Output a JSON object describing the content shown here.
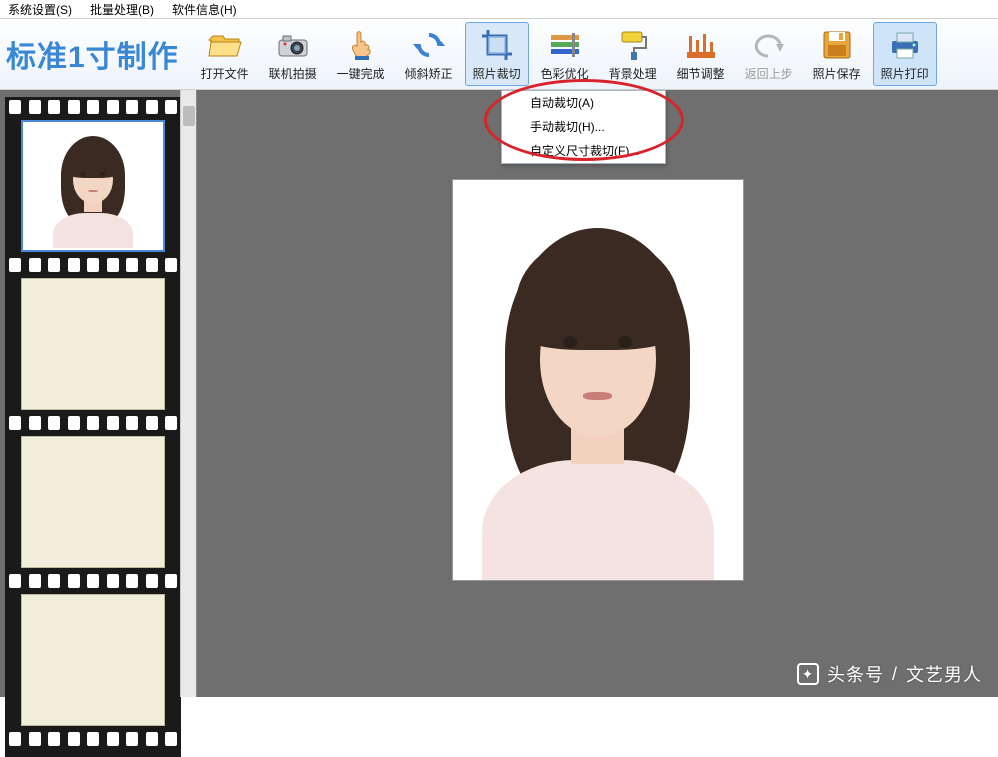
{
  "menu": {
    "sys": "系统设置(S)",
    "batch": "批量处理(B)",
    "info": "软件信息(H)"
  },
  "title": "标准1寸制作",
  "toolbar": {
    "open": "打开文件",
    "shoot": "联机拍摄",
    "onekey": "一键完成",
    "tilt": "倾斜矫正",
    "crop": "照片裁切",
    "color": "色彩优化",
    "bg": "背景处理",
    "detail": "细节调整",
    "undo": "返回上步",
    "save": "照片保存",
    "print": "照片打印"
  },
  "cropMenu": {
    "auto": "自动裁切(A)",
    "manual": "手动裁切(H)...",
    "custom": "自定义尺寸裁切(F)..."
  },
  "watermark": {
    "prefix": "头条号",
    "sep": "/",
    "name": "文艺男人"
  }
}
